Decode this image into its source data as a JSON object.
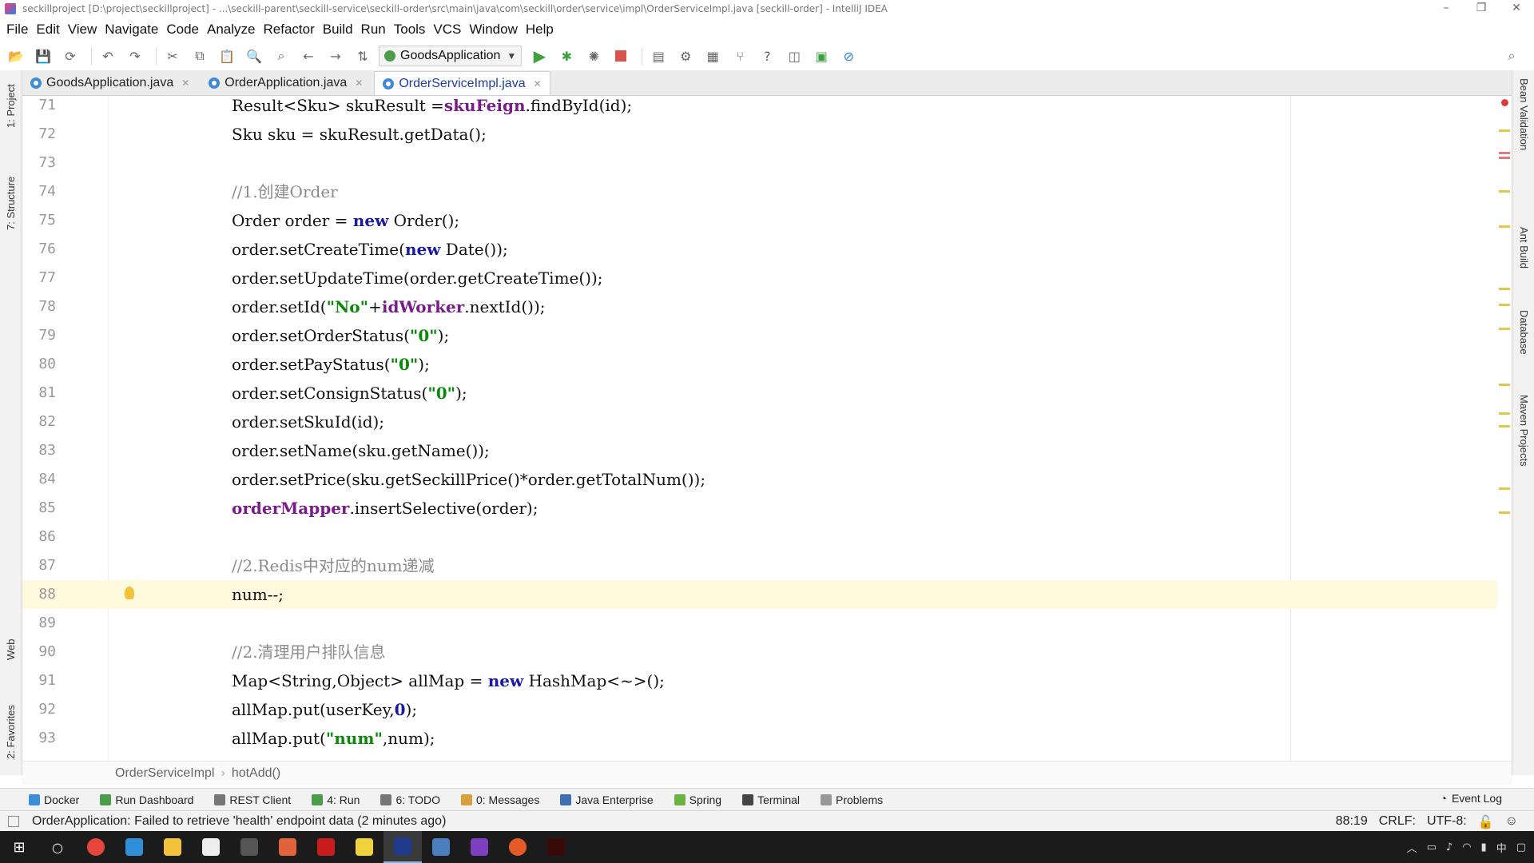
{
  "window": {
    "title": "seckillproject [D:\\project\\seckillproject] - ...\\seckill-parent\\seckill-service\\seckill-order\\src\\main\\java\\com\\seckill\\order\\service\\impl\\OrderServiceImpl.java [seckill-order] - IntelliJ IDEA"
  },
  "menu": [
    "File",
    "Edit",
    "View",
    "Navigate",
    "Code",
    "Analyze",
    "Refactor",
    "Build",
    "Run",
    "Tools",
    "VCS",
    "Window",
    "Help"
  ],
  "toolbar": {
    "run_config": "GoodsApplication"
  },
  "tabs": [
    {
      "label": "GoodsApplication.java",
      "active": false
    },
    {
      "label": "OrderApplication.java",
      "active": false
    },
    {
      "label": "OrderServiceImpl.java",
      "active": true
    }
  ],
  "left_tools": [
    "1: Project",
    "7: Structure",
    "Web",
    "2: Favorites"
  ],
  "right_tools": [
    "Bean Validation",
    "Ant Build",
    "Database",
    "Maven Projects"
  ],
  "code": {
    "current_line": 88,
    "lines": [
      {
        "n": "71",
        "segs": [
          [
            "t",
            "Result<Sku> skuResult ="
          ],
          [
            "f",
            "skuFeign"
          ],
          [
            "t",
            ".findById(id);"
          ]
        ]
      },
      {
        "n": "72",
        "segs": [
          [
            "t",
            "Sku sku = skuResult.getData();"
          ]
        ]
      },
      {
        "n": "73",
        "segs": []
      },
      {
        "n": "74",
        "segs": [
          [
            "c",
            "//1.创建Order"
          ]
        ]
      },
      {
        "n": "75",
        "segs": [
          [
            "t",
            "Order order = "
          ],
          [
            "k",
            "new"
          ],
          [
            "t",
            " Order();"
          ]
        ]
      },
      {
        "n": "76",
        "segs": [
          [
            "t",
            "order.setCreateTime("
          ],
          [
            "k",
            "new"
          ],
          [
            "t",
            " Date());"
          ]
        ]
      },
      {
        "n": "77",
        "segs": [
          [
            "t",
            "order.setUpdateTime(order.getCreateTime());"
          ]
        ]
      },
      {
        "n": "78",
        "segs": [
          [
            "t",
            "order.setId("
          ],
          [
            "s",
            "\"No\""
          ],
          [
            "t",
            "+"
          ],
          [
            "f",
            "idWorker"
          ],
          [
            "t",
            ".nextId());"
          ]
        ]
      },
      {
        "n": "79",
        "segs": [
          [
            "t",
            "order.setOrderStatus("
          ],
          [
            "s",
            "\"0\""
          ],
          [
            "t",
            ");"
          ]
        ]
      },
      {
        "n": "80",
        "segs": [
          [
            "t",
            "order.setPayStatus("
          ],
          [
            "s",
            "\"0\""
          ],
          [
            "t",
            ");"
          ]
        ]
      },
      {
        "n": "81",
        "segs": [
          [
            "t",
            "order.setConsignStatus("
          ],
          [
            "s",
            "\"0\""
          ],
          [
            "t",
            ");"
          ]
        ]
      },
      {
        "n": "82",
        "segs": [
          [
            "t",
            "order.setSkuId(id);"
          ]
        ]
      },
      {
        "n": "83",
        "segs": [
          [
            "t",
            "order.setName(sku.getName());"
          ]
        ]
      },
      {
        "n": "84",
        "segs": [
          [
            "t",
            "order.setPrice(sku.getSeckillPrice()*order.getTotalNum());"
          ]
        ]
      },
      {
        "n": "85",
        "segs": [
          [
            "f",
            "orderMapper"
          ],
          [
            "t",
            ".insertSelective(order);"
          ]
        ]
      },
      {
        "n": "86",
        "segs": []
      },
      {
        "n": "87",
        "segs": [
          [
            "c",
            "//2.Redis中对应的num递减"
          ]
        ]
      },
      {
        "n": "88",
        "segs": [
          [
            "t",
            "num--;"
          ]
        ]
      },
      {
        "n": "89",
        "segs": []
      },
      {
        "n": "90",
        "segs": [
          [
            "c",
            "//2.清理用户排队信息"
          ]
        ]
      },
      {
        "n": "91",
        "segs": [
          [
            "t",
            "Map<String,Object> allMap = "
          ],
          [
            "k",
            "new"
          ],
          [
            "t",
            " HashMap<~>();"
          ]
        ]
      },
      {
        "n": "92",
        "segs": [
          [
            "t",
            "allMap.put(userKey,"
          ],
          [
            "k",
            "0"
          ],
          [
            "t",
            ");"
          ]
        ]
      },
      {
        "n": "93",
        "segs": [
          [
            "t",
            "allMap.put("
          ],
          [
            "s",
            "\"num\""
          ],
          [
            "t",
            ",num);"
          ]
        ]
      }
    ]
  },
  "breadcrumb": [
    "OrderServiceImpl",
    "hotAdd()"
  ],
  "tool_windows": [
    {
      "label": "Docker",
      "color": "#3b8fd6"
    },
    {
      "label": "Run Dashboard",
      "color": "#4c9d4a"
    },
    {
      "label": "REST Client",
      "color": "#777777"
    },
    {
      "label": "4: Run",
      "color": "#4c9d4a"
    },
    {
      "label": "6: TODO",
      "color": "#777777"
    },
    {
      "label": "0: Messages",
      "color": "#d8a13a"
    },
    {
      "label": "Java Enterprise",
      "color": "#3d6fb3"
    },
    {
      "label": "Spring",
      "color": "#6db33f"
    },
    {
      "label": "Terminal",
      "color": "#444444"
    },
    {
      "label": "Problems",
      "color": "#999999"
    }
  ],
  "event_log": "Event Log",
  "status": {
    "message": "OrderApplication: Failed to retrieve 'health' endpoint data (2 minutes ago)",
    "position": "88:19",
    "line_sep": "CRLF:",
    "encoding": "UTF-8:"
  },
  "colors": {
    "keyword": "#1a1aa6",
    "string": "#0a8a0a",
    "field": "#7a1b8c",
    "comment": "#8c8c8c",
    "current_line": "#fff9dd"
  }
}
